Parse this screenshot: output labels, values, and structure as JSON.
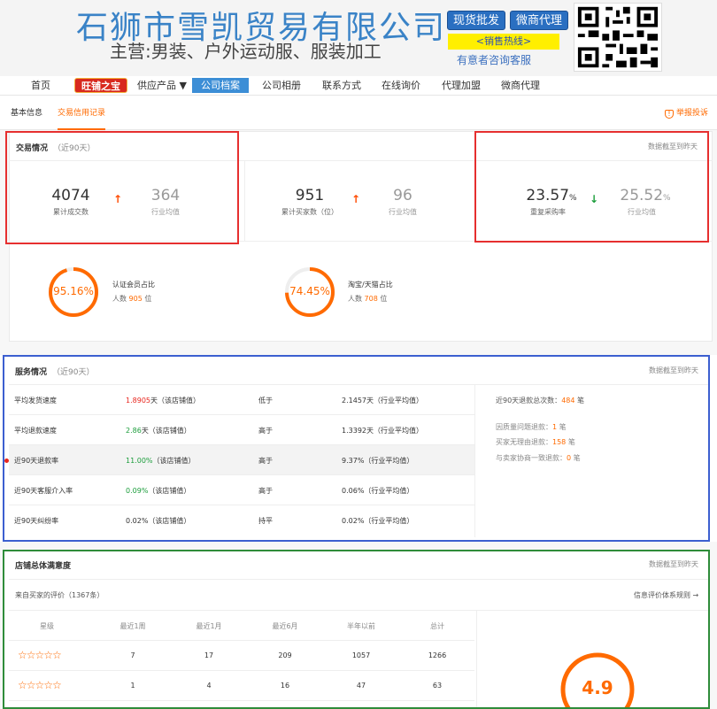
{
  "banner": {
    "company_name": "石狮市雪凯贸易有限公司",
    "main_business": "主营:男装、户外运动服、服装加工",
    "btn_wholesale": "现货批发",
    "btn_agent": "微商代理",
    "hotline": "<销售热线>",
    "consult": "有意者咨询客服"
  },
  "nav": {
    "items": [
      "首页",
      "旺铺之宝",
      "供应产品 ▼",
      "公司档案",
      "公司相册",
      "联系方式",
      "在线询价",
      "代理加盟",
      "微商代理"
    ]
  },
  "subtabs": {
    "basic": "基本信息",
    "credit": "交易信用记录",
    "report": "举报投诉"
  },
  "trade": {
    "title": "交易情况",
    "period": "（近90天）",
    "note": "数据截至到昨天",
    "cumulative_count": "4074",
    "cumulative_label": "累计成交数",
    "industry_avg_1": "364",
    "industry_label": "行业均值",
    "buyers": "951",
    "buyers_label": "累计买家数（位）",
    "industry_avg_2": "96",
    "repeat_rate": "23.57",
    "repeat_label": "重复采购率",
    "industry_avg_3": "25.52",
    "pct": "%",
    "cert_pct": "95.16%",
    "cert_title": "认证会员占比",
    "cert_sub_prefix": "人数",
    "cert_count": "905",
    "unit_person": "位",
    "taobao_pct": "74.45%",
    "taobao_title": "淘宝/天猫占比",
    "taobao_count": "708"
  },
  "service": {
    "title": "服务情况",
    "period": "（近90天）",
    "note": "数据截至到昨天",
    "rows": [
      {
        "name": "平均发货速度",
        "value": "1.8905",
        "unit": "天（该店铺值）",
        "cmp": "低于",
        "avg": "2.1457天（行业平均值）"
      },
      {
        "name": "平均退款速度",
        "value": "2.86",
        "unit": "天（该店铺值）",
        "cmp": "高于",
        "avg": "1.3392天（行业平均值）"
      },
      {
        "name": "近90天退款率",
        "value": "11.00%",
        "unit": "（该店铺值）",
        "cmp": "高于",
        "avg": "9.37%（行业平均值）"
      },
      {
        "name": "近90天客服介入率",
        "value": "0.09%",
        "unit": "（该店铺值）",
        "cmp": "高于",
        "avg": "0.06%（行业平均值）"
      },
      {
        "name": "近90天纠纷率",
        "value": "0.02%",
        "unit": "（该店铺值）",
        "cmp": "持平",
        "avg": "0.02%（行业平均值）"
      }
    ],
    "refund_total_label": "近90天退款总次数：",
    "refund_total": "484",
    "refund_unit": "笔",
    "quality_label": "因质量问题退款：",
    "quality_count": "1",
    "no_reason_label": "买家无理由退款：",
    "no_reason_count": "158",
    "agreed_label": "与卖家协商一致退款：",
    "agreed_count": "0"
  },
  "satisfaction": {
    "title": "店铺总体满意度",
    "note": "数据截至到昨天",
    "from_buyers": "来自买家的评价（1367条）",
    "rules_link": "信息评价体系规则 →",
    "headers": [
      "星级",
      "最近1周",
      "最近1月",
      "最近6月",
      "半年以前",
      "总计"
    ],
    "rows": [
      {
        "stars": "☆☆☆☆☆",
        "cells": [
          "7",
          "17",
          "209",
          "1057",
          "1266"
        ]
      },
      {
        "stars": "☆☆☆☆☆",
        "cells": [
          "1",
          "4",
          "16",
          "47",
          "63"
        ]
      }
    ],
    "score": "4.9"
  },
  "colors": {
    "orange": "#ff6a00",
    "red_box": "#e62f2f",
    "blue_box": "#3c5fd0",
    "green_box": "#2f8c3a"
  }
}
